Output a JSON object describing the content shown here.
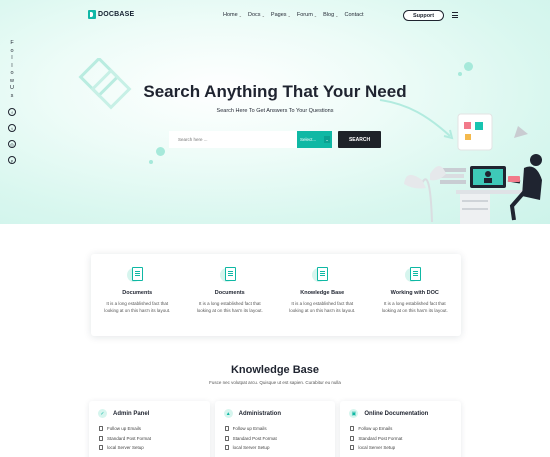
{
  "brand": {
    "name": "DOCBASE",
    "accent": "#0fb8a4",
    "dark": "#1e2228"
  },
  "nav": {
    "items": [
      {
        "label": "Home",
        "caret": "⌄"
      },
      {
        "label": "Docs",
        "caret": "⌄"
      },
      {
        "label": "Pages",
        "caret": "⌄"
      },
      {
        "label": "Forum",
        "caret": "⌄"
      },
      {
        "label": "Blog",
        "caret": "⌄"
      },
      {
        "label": "Contact",
        "caret": ""
      }
    ],
    "support": "Support"
  },
  "follow": {
    "letters": [
      "F",
      "o",
      "l",
      "l",
      "o",
      "w",
      "U",
      "s"
    ],
    "socials": [
      {
        "name": "facebook-icon",
        "glyph": "f"
      },
      {
        "name": "twitter-icon",
        "glyph": "t"
      },
      {
        "name": "instagram-icon",
        "glyph": "◎"
      },
      {
        "name": "pinterest-icon",
        "glyph": "p"
      }
    ]
  },
  "hero": {
    "title": "Search Anything That Your Need",
    "subtitle": "Search Here To Get Answers To Your Questions",
    "search_placeholder": "Search here ...",
    "select_value": "Select...",
    "select_caret": "⌄",
    "search_button": "SEARCH"
  },
  "features": [
    {
      "title": "Documents",
      "desc": "It is a long established fact that looking at on this has'n its layout."
    },
    {
      "title": "Documents",
      "desc": "It is a long established fact that looking at on this has'n its layout."
    },
    {
      "title": "Knowledge Base",
      "desc": "It is a long established fact that looking at on this has'n its layout."
    },
    {
      "title": "Working with DOC",
      "desc": "It is a long established fact that looking at on this has'n its layout."
    }
  ],
  "knowledge_base": {
    "title": "Knowledge Base",
    "subtitle": "Fusce nec volutpat arcu. Quisque ut est sapien. Curabitur eu nulla",
    "cards": [
      {
        "name": "Admin Panel",
        "icon": "✓",
        "items": [
          "Follow up Emails",
          "Standard Post Format",
          "local Server Setup"
        ]
      },
      {
        "name": "Administration",
        "icon": "▲",
        "items": [
          "Follow up Emails",
          "Standard Post Format",
          "local Server Setup"
        ]
      },
      {
        "name": "Online Documentation",
        "icon": "▣",
        "items": [
          "Follow up Emails",
          "Standard Post Format",
          "local Server Setup"
        ]
      }
    ]
  }
}
